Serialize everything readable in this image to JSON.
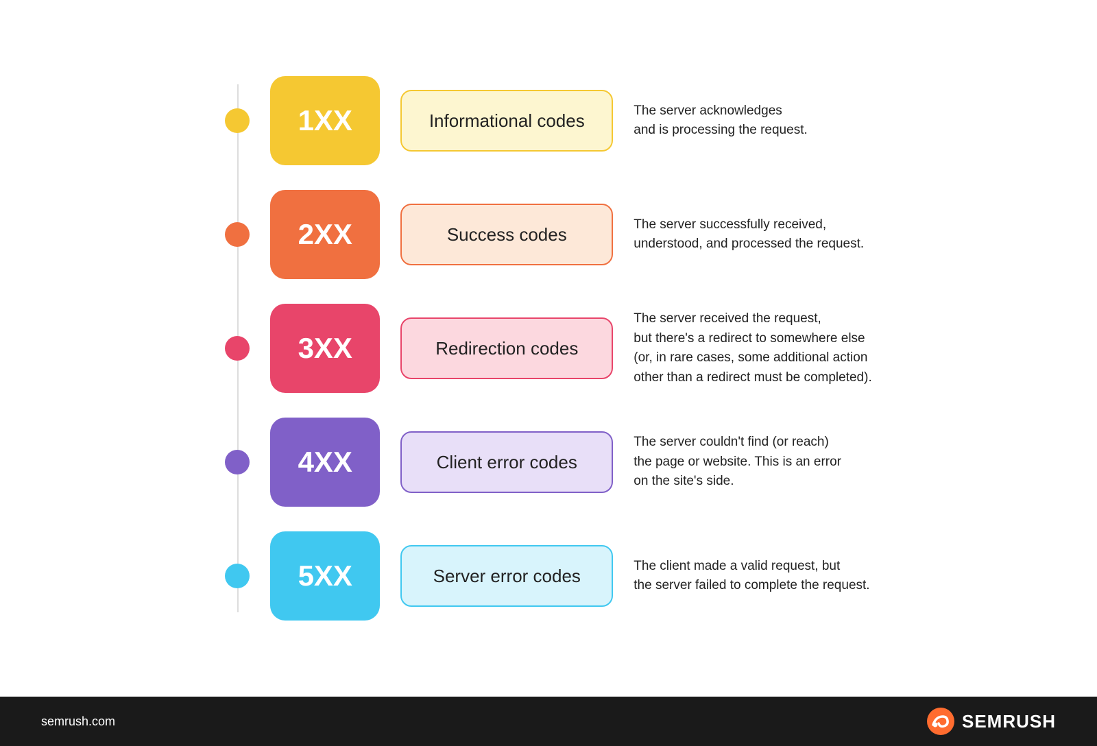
{
  "rows": [
    {
      "id": "1xx",
      "dot_class": "dot-1",
      "code_class": "code-1",
      "label_class": "label-1",
      "code": "1XX",
      "label": "Informational codes",
      "description": "The server acknowledges\nand is processing the request."
    },
    {
      "id": "2xx",
      "dot_class": "dot-2",
      "code_class": "code-2",
      "label_class": "label-2",
      "code": "2XX",
      "label": "Success codes",
      "description": "The server successfully received,\nunderstood, and processed the request."
    },
    {
      "id": "3xx",
      "dot_class": "dot-3",
      "code_class": "code-3",
      "label_class": "label-3",
      "code": "3XX",
      "label": "Redirection codes",
      "description": "The server received the request,\nbut there's a redirect to somewhere else\n(or, in rare cases, some additional action\nother than a redirect must be completed)."
    },
    {
      "id": "4xx",
      "dot_class": "dot-4",
      "code_class": "code-4",
      "label_class": "label-4",
      "code": "4XX",
      "label": "Client error codes",
      "description": "The server couldn't find (or reach)\nthe page or website. This is an error\non the site's side."
    },
    {
      "id": "5xx",
      "dot_class": "dot-5",
      "code_class": "code-5",
      "label_class": "label-5",
      "code": "5XX",
      "label": "Server error codes",
      "description": "The client made a valid request, but\nthe server failed to complete the request."
    }
  ],
  "footer": {
    "url": "semrush.com",
    "brand": "SEMRUSH"
  }
}
